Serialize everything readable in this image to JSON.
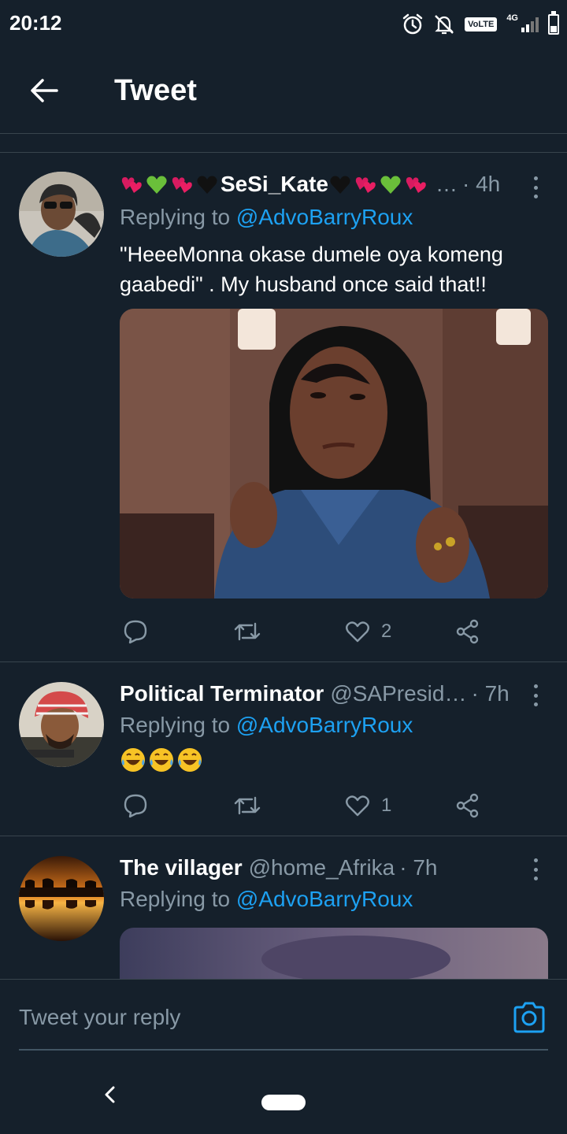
{
  "status_bar": {
    "time": "20:12",
    "volte": "VoLTE",
    "network": "4G"
  },
  "header": {
    "title": "Tweet"
  },
  "tweets": [
    {
      "name": "SeSi_Kate",
      "handle": "…",
      "time": "· 4h",
      "reply_prefix": "Replying to ",
      "reply_to": "@AdvoBarryRoux",
      "text": "\"HeeeMonna okase dumele oya komeng gaabedi\" . My husband once said that!!",
      "likes": "2"
    },
    {
      "name": "Political Terminator",
      "handle": "@SAPresid…",
      "time": "· 7h",
      "reply_prefix": "Replying to ",
      "reply_to": "@AdvoBarryRoux",
      "text": "😂😂😂",
      "likes": "1"
    },
    {
      "name": "The villager",
      "handle": "@home_Afrika",
      "time": "· 7h",
      "reply_prefix": "Replying to ",
      "reply_to": "@AdvoBarryRoux"
    }
  ],
  "composer": {
    "placeholder": "Tweet your reply"
  },
  "colors": {
    "background": "#15202b",
    "accent": "#1da1f2",
    "muted": "#8899a6",
    "divider": "#38444d"
  },
  "icons": [
    "alarm-icon",
    "bell-off-icon",
    "signal-icon",
    "battery-icon",
    "back-arrow-icon",
    "more-icon",
    "reply-icon",
    "retweet-icon",
    "like-icon",
    "share-icon",
    "camera-icon",
    "nav-back-icon"
  ]
}
